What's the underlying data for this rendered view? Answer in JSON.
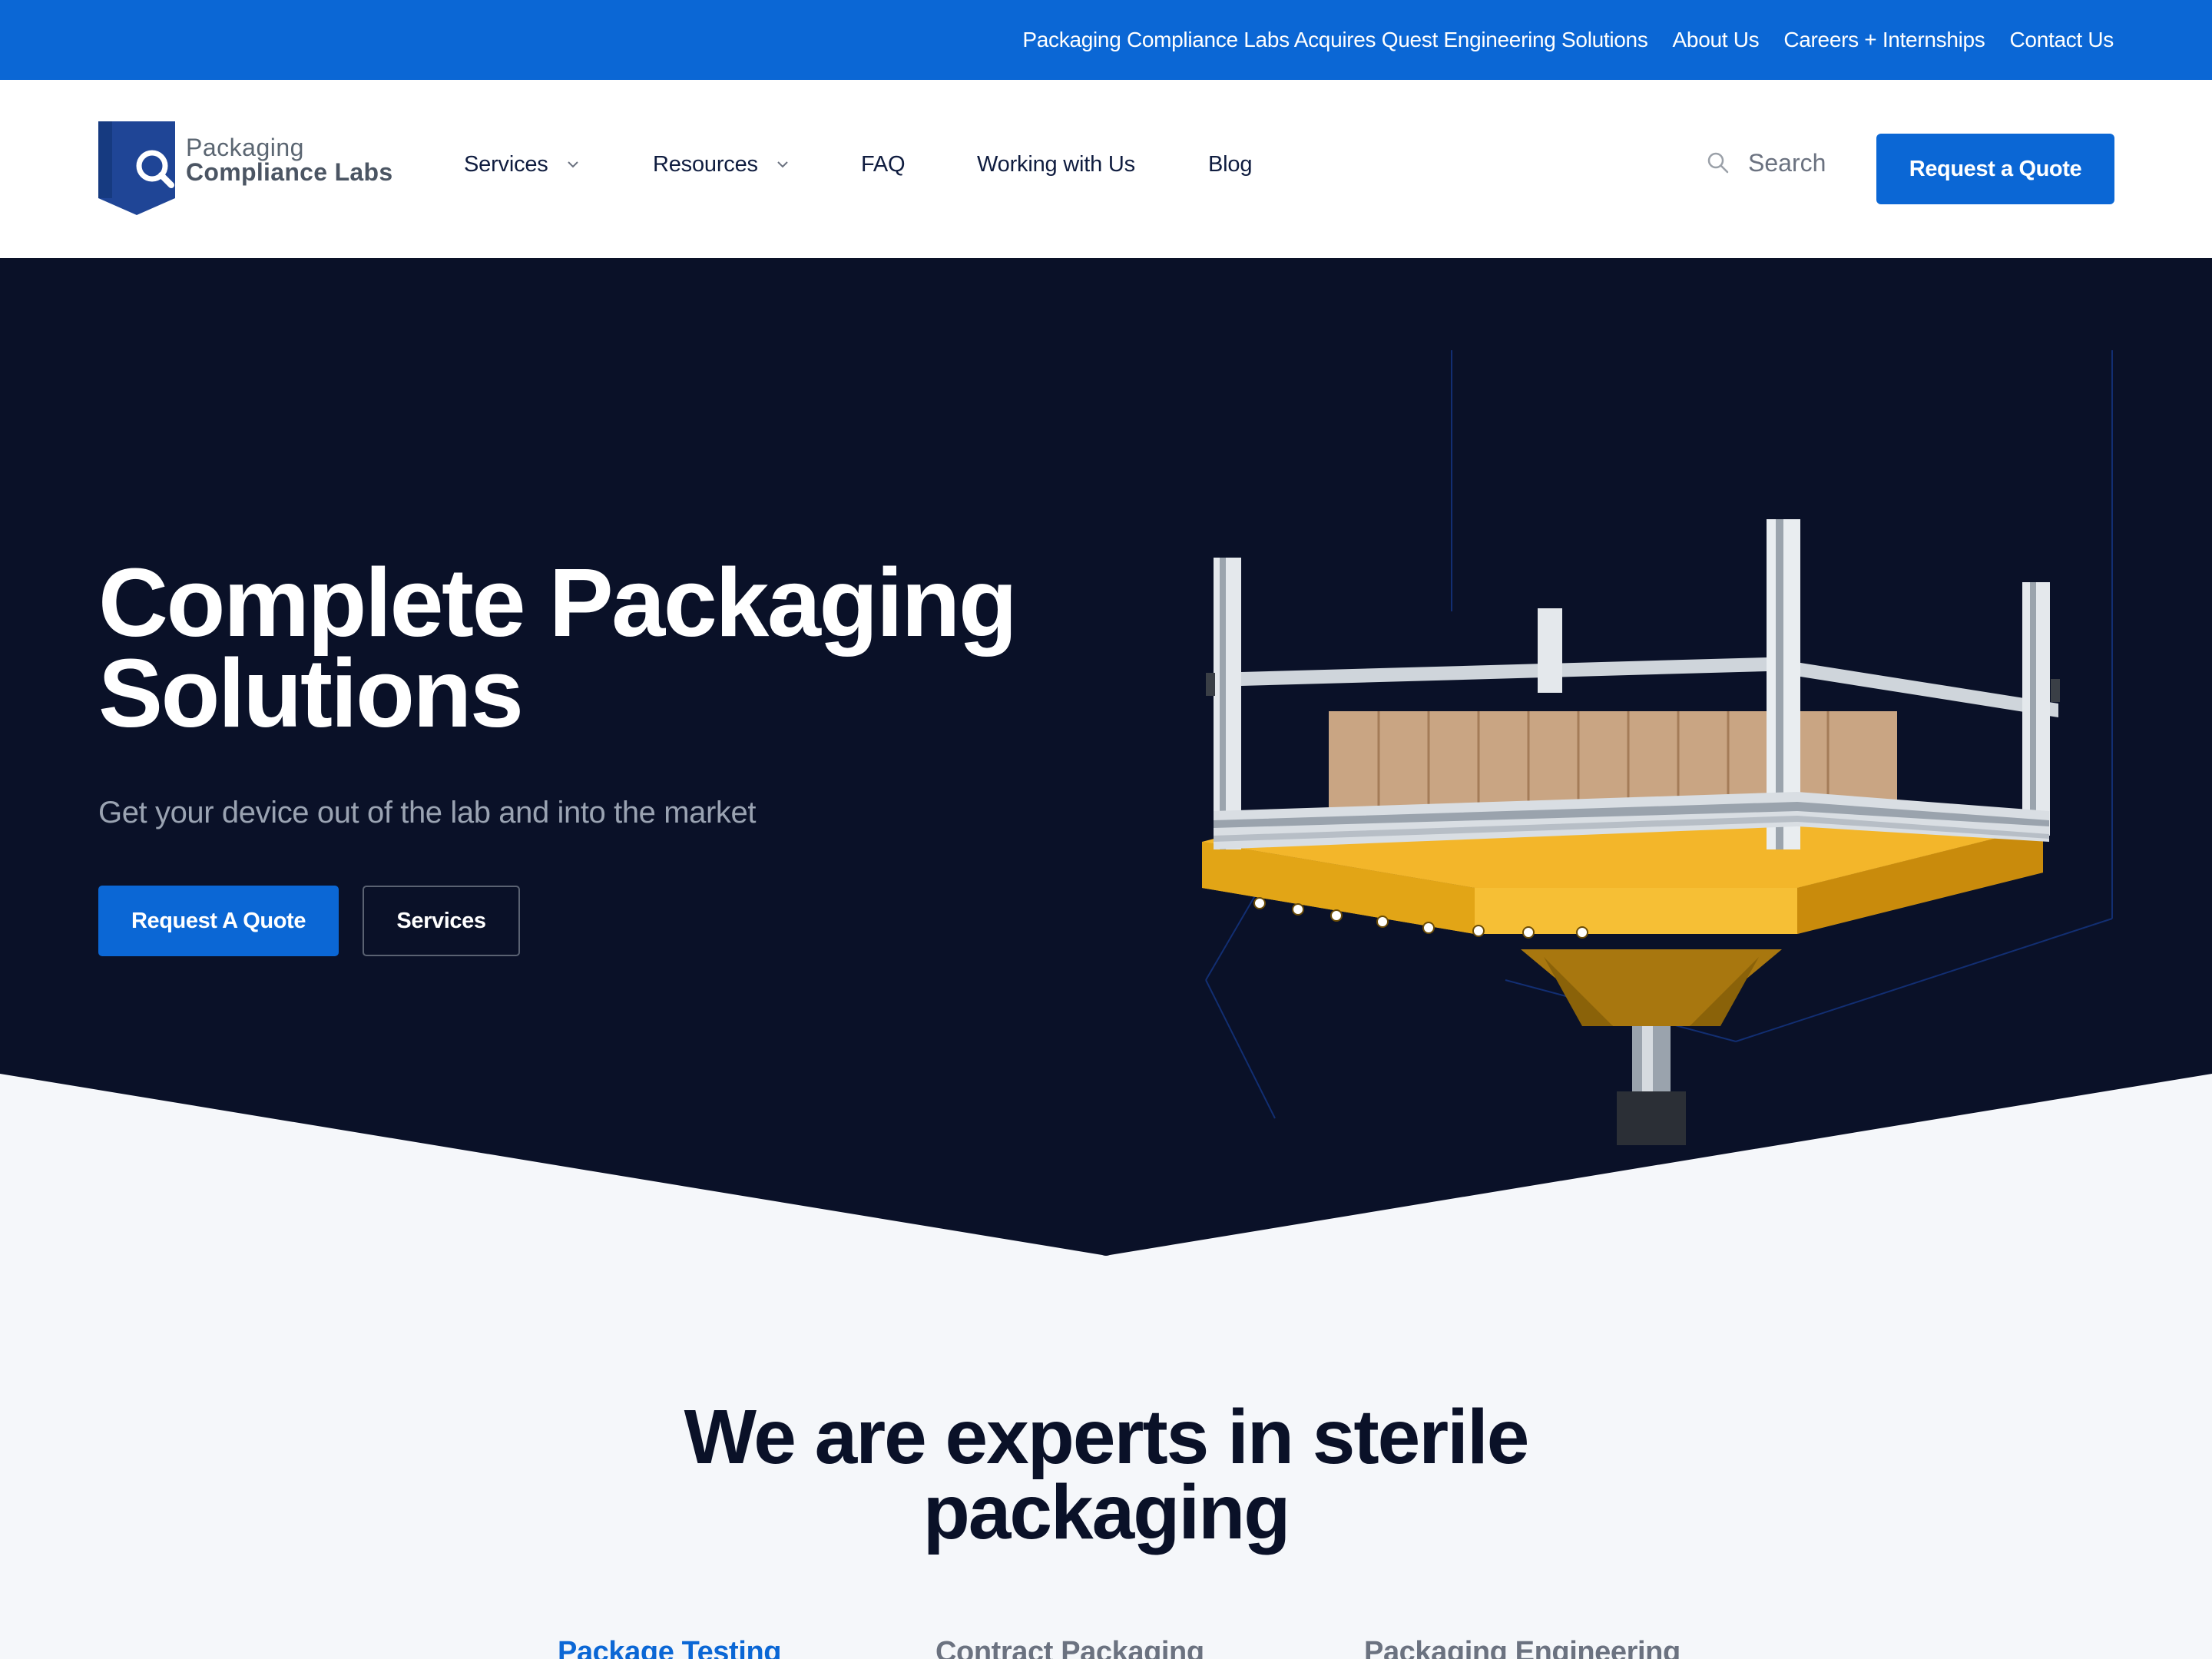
{
  "topbar": {
    "links": [
      "Packaging Compliance Labs Acquires Quest Engineering Solutions",
      "About Us",
      "Careers + Internships",
      "Contact Us"
    ],
    "background": "#0b67d5"
  },
  "logo": {
    "line1": "Packaging",
    "line2": "Compliance Labs",
    "color": "#1f4596"
  },
  "nav": {
    "items": [
      {
        "label": "Services",
        "has_dropdown": true
      },
      {
        "label": "Resources",
        "has_dropdown": true
      },
      {
        "label": "FAQ",
        "has_dropdown": false
      },
      {
        "label": "Working with Us",
        "has_dropdown": false
      },
      {
        "label": "Blog",
        "has_dropdown": false
      }
    ],
    "search_label": "Search",
    "search_icon": "search-icon",
    "quote_button": "Request a Quote"
  },
  "hero": {
    "title_line1": "Complete Packaging",
    "title_line2": "Solutions",
    "subtitle": "Get your device out of the lab and into the market",
    "primary_button": "Request A Quote",
    "secondary_button": "Services",
    "background": "#0a1128"
  },
  "experts": {
    "title_line1": "We are experts in sterile",
    "title_line2": "packaging",
    "tabs": [
      {
        "label": "Package Testing",
        "active": true
      },
      {
        "label": "Contract Packaging",
        "active": false
      },
      {
        "label": "Packaging Engineering",
        "active": false
      }
    ]
  },
  "colors": {
    "accent": "#0b67d5",
    "dark_navy": "#0a1128",
    "light_bg": "#f5f7fa"
  }
}
